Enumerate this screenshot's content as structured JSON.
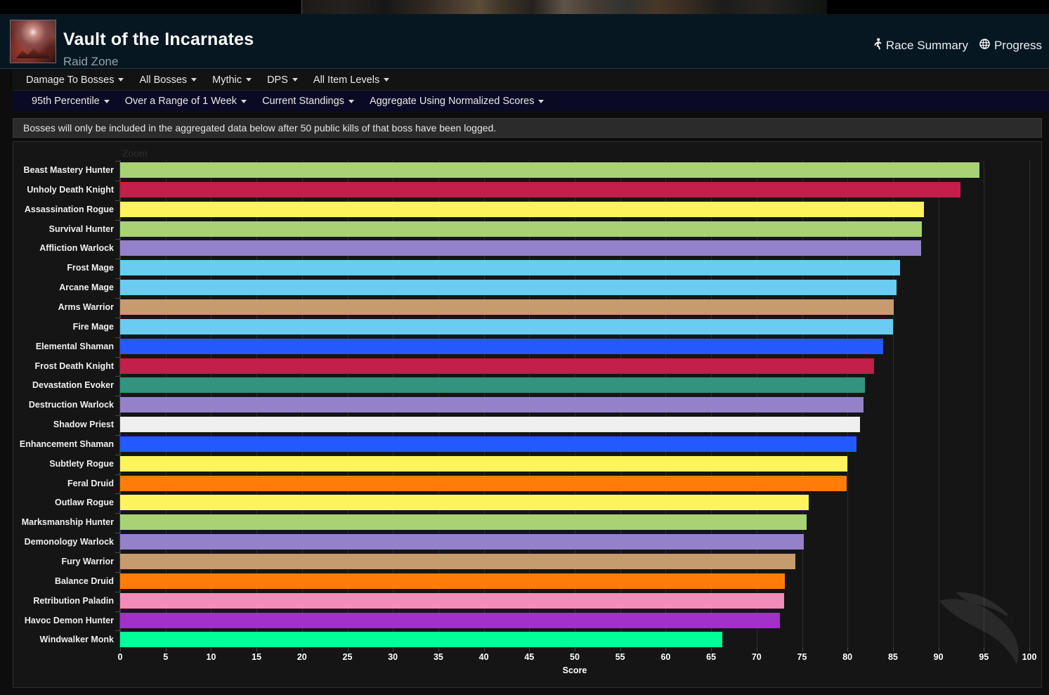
{
  "header": {
    "title": "Vault of the Incarnates",
    "subtitle": "Raid Zone",
    "thumbnail_name": "raid-zone-thumbnail",
    "links": [
      {
        "label": "Race Summary",
        "icon": "runner-icon",
        "glyph": "↯"
      },
      {
        "label": "Progress",
        "icon": "globe-icon",
        "glyph": "◔"
      }
    ]
  },
  "nav_primary": [
    {
      "label": "Damage To Bosses",
      "has_caret": true
    },
    {
      "label": "All Bosses",
      "has_caret": true
    },
    {
      "label": "Mythic",
      "has_caret": true
    },
    {
      "label": "DPS",
      "has_caret": true
    },
    {
      "label": "All Item Levels",
      "has_caret": true
    }
  ],
  "nav_secondary": [
    {
      "label": "95th Percentile",
      "has_caret": true
    },
    {
      "label": "Over a Range of 1 Week",
      "has_caret": true
    },
    {
      "label": "Current Standings",
      "has_caret": true
    },
    {
      "label": "Aggregate Using Normalized Scores",
      "has_caret": true
    }
  ],
  "notice": "Bosses will only be included in the aggregated data below after 50 public kills of that boss have been logged.",
  "chart_controls": {
    "zoom_label": "Zoom"
  },
  "chart_data": {
    "type": "bar",
    "orientation": "horizontal",
    "title": "",
    "xlabel": "Score",
    "ylabel": "",
    "xlim": [
      0,
      100
    ],
    "xticks": [
      0,
      5,
      10,
      15,
      20,
      25,
      30,
      35,
      40,
      45,
      50,
      55,
      60,
      65,
      70,
      75,
      80,
      85,
      90,
      95,
      100
    ],
    "grid": true,
    "legend": "none",
    "categories": [
      "Beast Mastery Hunter",
      "Unholy Death Knight",
      "Assassination Rogue",
      "Survival Hunter",
      "Affliction Warlock",
      "Frost Mage",
      "Arcane Mage",
      "Arms Warrior",
      "Fire Mage",
      "Elemental Shaman",
      "Frost Death Knight",
      "Devastation Evoker",
      "Destruction Warlock",
      "Shadow Priest",
      "Enhancement Shaman",
      "Subtlety Rogue",
      "Feral Druid",
      "Outlaw Rogue",
      "Marksmanship Hunter",
      "Demonology Warlock",
      "Fury Warrior",
      "Balance Druid",
      "Retribution Paladin",
      "Havoc Demon Hunter",
      "Windwalker Monk"
    ],
    "values": [
      94.5,
      92.4,
      88.4,
      88.2,
      88.1,
      85.8,
      85.4,
      85.1,
      85.0,
      83.9,
      82.9,
      81.9,
      81.8,
      81.4,
      81.0,
      80.0,
      79.9,
      75.7,
      75.5,
      75.2,
      74.3,
      73.1,
      73.0,
      72.6,
      66.2
    ],
    "colors": [
      "#a9d275",
      "#c41e4a",
      "#fdf45c",
      "#a9d275",
      "#9382c9",
      "#69ccf0",
      "#69ccf0",
      "#c69b6d",
      "#69ccf0",
      "#2459ff",
      "#c41e4a",
      "#33937f",
      "#9382c9",
      "#efefef",
      "#2459ff",
      "#fdf45c",
      "#ff7c0a",
      "#fdf45c",
      "#a9d275",
      "#9382c9",
      "#c69b6d",
      "#ff7c0a",
      "#f48cba",
      "#a330c9",
      "#00ff98"
    ]
  }
}
